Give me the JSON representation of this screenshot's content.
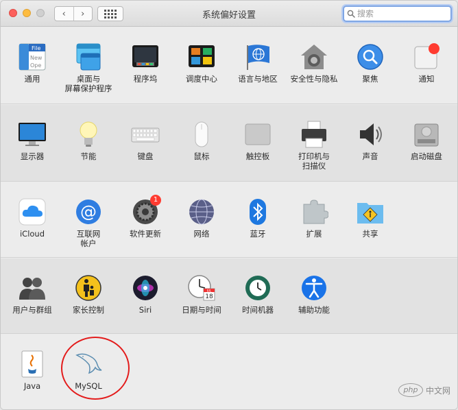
{
  "window": {
    "title": "系统偏好设置"
  },
  "toolbar": {
    "back_glyph": "‹",
    "forward_glyph": "›",
    "search_placeholder": "搜索"
  },
  "sections": [
    {
      "items": [
        {
          "label": "通用"
        },
        {
          "label": "桌面与\n屏幕保护程序"
        },
        {
          "label": "程序坞"
        },
        {
          "label": "调度中心"
        },
        {
          "label": "语言与地区"
        },
        {
          "label": "安全性与隐私"
        },
        {
          "label": "聚焦"
        },
        {
          "label": "通知"
        }
      ]
    },
    {
      "items": [
        {
          "label": "显示器"
        },
        {
          "label": "节能"
        },
        {
          "label": "键盘"
        },
        {
          "label": "鼠标"
        },
        {
          "label": "触控板"
        },
        {
          "label": "打印机与\n扫描仪"
        },
        {
          "label": "声音"
        },
        {
          "label": "启动磁盘"
        }
      ]
    },
    {
      "items": [
        {
          "label": "iCloud"
        },
        {
          "label": "互联网\n帐户"
        },
        {
          "label": "软件更新",
          "badge": "1"
        },
        {
          "label": "网络"
        },
        {
          "label": "蓝牙"
        },
        {
          "label": "扩展"
        },
        {
          "label": "共享"
        }
      ]
    },
    {
      "items": [
        {
          "label": "用户与群组"
        },
        {
          "label": "家长控制"
        },
        {
          "label": "Siri"
        },
        {
          "label": "日期与时间",
          "calendar_day": "18",
          "calendar_month": "JUL"
        },
        {
          "label": "时间机器"
        },
        {
          "label": "辅助功能"
        }
      ]
    },
    {
      "items": [
        {
          "label": "Java"
        },
        {
          "label": "MySQL"
        }
      ]
    }
  ],
  "general_icon_text": [
    "File",
    "New",
    "Ope"
  ],
  "watermark": {
    "logo": "php",
    "text": "中文网"
  },
  "colors": {
    "accent": "#2f7de1",
    "badge": "#ff3b30",
    "annotation": "#e31b1b"
  }
}
